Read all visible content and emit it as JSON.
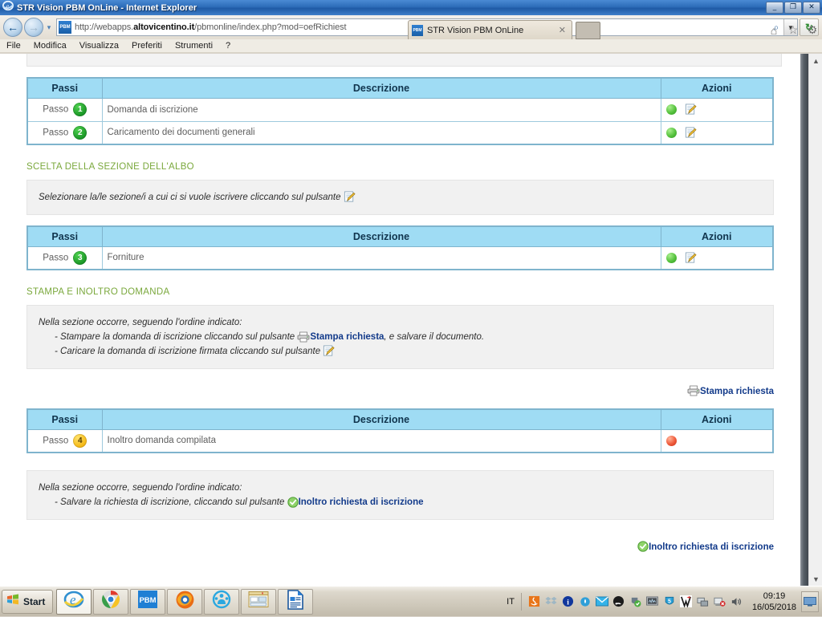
{
  "window": {
    "title": "STR Vision PBM OnLine - Internet Explorer",
    "minimize_label": "_",
    "maximize_label": "❐",
    "close_label": "✕"
  },
  "browser": {
    "back_label": "←",
    "forward_label": "→",
    "history_label": "▾",
    "refresh_label": "↻",
    "favicon_text": "PBM",
    "url_prefix": "http://webapps.",
    "url_domain": "altovicentino.it",
    "url_suffix": "/pbmonline/index.php?mod=oefRichiest",
    "search_icon": "⌕",
    "dropdown_icon": "▼",
    "menu": [
      "File",
      "Modifica",
      "Visualizza",
      "Preferiti",
      "Strumenti",
      "?"
    ],
    "tab": {
      "favicon_text": "PBM",
      "title": "STR Vision PBM OnLine",
      "close_label": "✕"
    },
    "toolbar_icons": [
      "home-icon",
      "favorites-icon",
      "settings-icon"
    ],
    "scroll_up": "▲",
    "scroll_down": "▼"
  },
  "page": {
    "table_headers": {
      "passi": "Passi",
      "descrizione": "Descrizione",
      "azioni": "Azioni"
    },
    "step_word": "Passo",
    "table1": {
      "rows": [
        {
          "num": "1",
          "badge": "green",
          "desc": "Domanda di iscrizione",
          "status": "green",
          "has_edit": true
        },
        {
          "num": "2",
          "badge": "green",
          "desc": "Caricamento dei documenti generali",
          "status": "green",
          "has_edit": true
        }
      ]
    },
    "section_albo": {
      "title": "SCELTA DELLA SEZIONE DELL'ALBO",
      "text": "Selezionare la/le sezione/i a cui ci si vuole iscrivere cliccando sul pulsante"
    },
    "table2": {
      "rows": [
        {
          "num": "3",
          "badge": "green",
          "desc": "Forniture",
          "status": "green",
          "has_edit": true
        }
      ]
    },
    "section_stampa": {
      "title": "STAMPA E INOLTRO DOMANDA",
      "line1": "Nella sezione occorre, seguendo l'ordine indicato:",
      "line2_a": "- Stampare la domanda di iscrizione cliccando sul pulsante",
      "line2_link": "Stampa richiesta",
      "line2_b": ", e salvare il documento.",
      "line3": "- Caricare la domanda di iscrizione firmata cliccando sul pulsante"
    },
    "stampa_link": "Stampa richiesta",
    "table3": {
      "rows": [
        {
          "num": "4",
          "badge": "yellow",
          "desc": "Inoltro domanda compilata",
          "status": "red",
          "has_edit": false
        }
      ]
    },
    "section_inoltro": {
      "line1": "Nella sezione occorre, seguendo l'ordine indicato:",
      "line2_a": "- Salvare la richiesta di iscrizione, cliccando sul pulsante",
      "line2_link": "Inoltro richiesta di iscrizione"
    },
    "inoltro_link": "Inoltro richiesta di iscrizione"
  },
  "taskbar": {
    "start_label": "Start",
    "buttons": [
      "internet-explorer-taskbar-icon",
      "chrome-taskbar-icon",
      "pbm-taskbar-icon",
      "firefox-taskbar-icon",
      "teamviewer-taskbar-icon",
      "file-explorer-taskbar-icon",
      "libreoffice-taskbar-icon"
    ],
    "pbm_label": "PBM",
    "language": "IT",
    "tray_icons": [
      "java-tray-icon",
      "dropbox-tray-icon",
      "info-tray-icon",
      "water-drop-tray-icon",
      "mail-tray-icon",
      "rss-tray-icon",
      "security-shield-tray-icon",
      "monitor-tray-icon",
      "shield-5-tray-icon",
      "avira-tray-icon",
      "network-tray-icon",
      "network-error-tray-icon",
      "volume-tray-icon"
    ],
    "clock_time": "09:19",
    "clock_date": "16/05/2018",
    "show_desktop": "show-desktop-button"
  },
  "colors": {
    "title_blue": "#2c6cb8",
    "table_header_blue": "#9fdcf4",
    "table_border": "#7fb4cd",
    "section_green": "#7aa83c",
    "link_blue": "#123a8a",
    "badge_green": "#1d9a29",
    "badge_yellow": "#f5ba18",
    "status_red": "#ef5a3a"
  }
}
